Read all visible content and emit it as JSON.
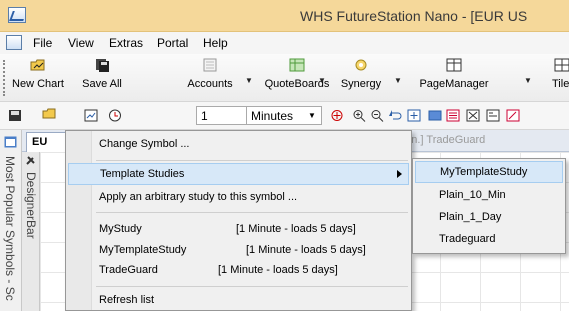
{
  "window": {
    "title": "WHS FutureStation Nano - [EUR US"
  },
  "menubar": {
    "items": [
      "File",
      "View",
      "Extras",
      "Portal",
      "Help"
    ]
  },
  "toolbar": {
    "buttons": [
      {
        "label": "New Chart",
        "icon": "folder-chart-icon"
      },
      {
        "label": "Save All",
        "icon": "save-all-icon"
      },
      {
        "label": "Accounts",
        "icon": "accounts-icon"
      },
      {
        "label": "QuoteBoards",
        "icon": "quoteboards-icon"
      },
      {
        "label": "Synergy",
        "icon": "synergy-icon"
      },
      {
        "label": "PageManager",
        "icon": "pagemanager-icon"
      },
      {
        "label": "Tile",
        "icon": "tile-icon"
      }
    ]
  },
  "toolbar2": {
    "interval_value": "1",
    "interval_unit": "Minutes"
  },
  "doc_tab": {
    "label": "EU",
    "info": "ulation [1 Min.]  TradeGuard"
  },
  "left_panel": {
    "label": "Most Popular Symbols - Sc"
  },
  "designer_bar": {
    "label": "DesignerBar"
  },
  "context_menu": {
    "change_symbol": "Change Symbol ...",
    "template_studies": "Template Studies",
    "apply_study": "Apply an arbitrary study to this symbol ...",
    "studies": [
      {
        "name": "MyStudy",
        "info": "[1 Minute - loads 5 days]"
      },
      {
        "name": "MyTemplateStudy",
        "info": "[1 Minute - loads 5 days]"
      },
      {
        "name": "TradeGuard",
        "info": "[1 Minute - loads 5 days]"
      }
    ],
    "refresh": "Refresh list"
  },
  "submenu": {
    "items": [
      "MyTemplateStudy",
      "Plain_10_Min",
      "Plain_1_Day",
      "Tradeguard"
    ]
  }
}
